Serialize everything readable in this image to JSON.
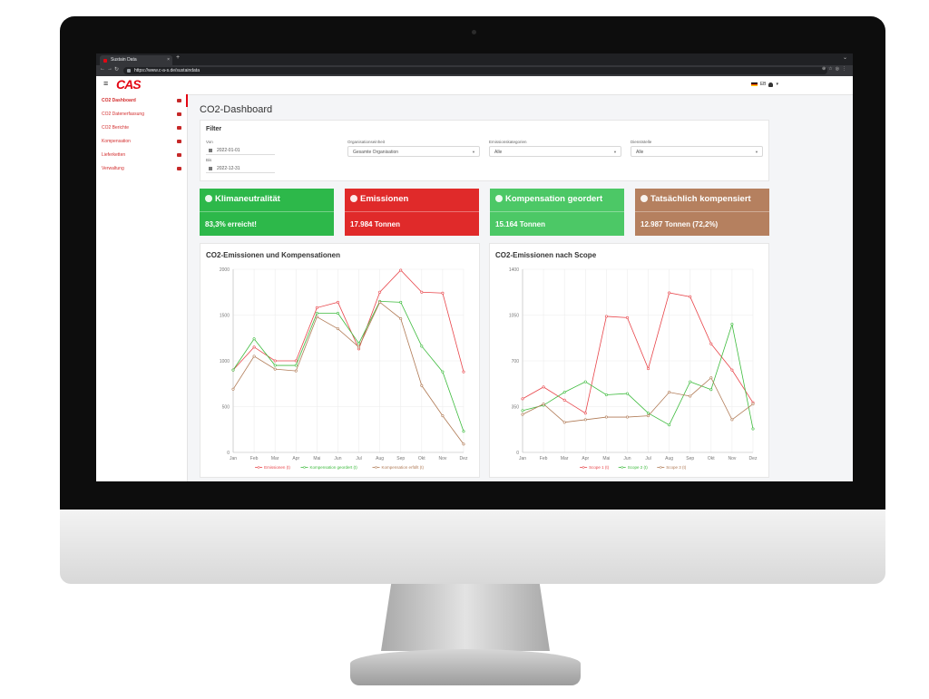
{
  "browser": {
    "tab_title": "Sustain Data",
    "tab_close": "×",
    "new_tab": "+",
    "url": "https://www.c-a-s.de/sustaindata",
    "back_icon": "arrow-left-icon",
    "forward_icon": "arrow-right-icon",
    "reload_icon": "reload-icon"
  },
  "header": {
    "logo": "CAS",
    "language": "EB"
  },
  "sidebar": {
    "items": [
      {
        "label": "CO2 Dashboard",
        "icon": "home-icon",
        "active": true
      },
      {
        "label": "CO2 Datenerfassung",
        "icon": "keyboard-icon"
      },
      {
        "label": "CO2 Berichte",
        "icon": "book-icon"
      },
      {
        "label": "Kompensation",
        "icon": "money-icon"
      },
      {
        "label": "Lieferketten",
        "icon": "truck-icon"
      },
      {
        "label": "Verwaltung",
        "icon": "wrench-icon"
      }
    ]
  },
  "page": {
    "title": "CO2-Dashboard"
  },
  "filter": {
    "heading": "Filter",
    "from_label": "Von",
    "from_value": "2022-01-01",
    "to_label": "Bis",
    "to_value": "2022-12-31",
    "org_label": "Organisationseinheit",
    "org_value": "Gesamte Organisation",
    "category_label": "Emissionskategorien",
    "category_value": "Alle",
    "service_label": "Dienststelle",
    "service_value": "Alle"
  },
  "kpis": [
    {
      "title": "Klimaneutralität",
      "value": "83,3% erreicht!",
      "color": "#2db84a",
      "icon": "globe-icon"
    },
    {
      "title": "Emissionen",
      "value": "17.984 Tonnen",
      "color": "#e02a2a",
      "icon": "industry-icon"
    },
    {
      "title": "Kompensation geordert",
      "value": "15.164 Tonnen",
      "color": "#4cc866",
      "icon": "tree-icon"
    },
    {
      "title": "Tatsächlich kompensiert",
      "value": "12.987 Tonnen (72,2%)",
      "color": "#b5805f",
      "icon": "clock-icon"
    }
  ],
  "chart_data": [
    {
      "type": "line",
      "title": "CO2-Emissionen und Kompensationen",
      "categories": [
        "Jan",
        "Feb",
        "Mar",
        "Apr",
        "Mai",
        "Jun",
        "Jul",
        "Aug",
        "Sep",
        "Okt",
        "Nov",
        "Dez"
      ],
      "ylim": [
        0,
        2000
      ],
      "yticks": [
        0,
        500,
        1000,
        1500,
        2000
      ],
      "grid": true,
      "legend": "bottom",
      "series": [
        {
          "name": "Emissionen (t)",
          "color": "#e8454a",
          "values": [
            900,
            1150,
            1000,
            1000,
            1580,
            1640,
            1130,
            1750,
            1990,
            1750,
            1740,
            880
          ]
        },
        {
          "name": "Kompensation geordert (t)",
          "color": "#3dbb3d",
          "values": [
            900,
            1240,
            950,
            950,
            1520,
            1520,
            1190,
            1650,
            1640,
            1160,
            880,
            230
          ]
        },
        {
          "name": "Kompensation erfüllt (t)",
          "color": "#b07a55",
          "values": [
            690,
            1050,
            910,
            890,
            1480,
            1350,
            1150,
            1640,
            1460,
            730,
            400,
            90
          ]
        }
      ]
    },
    {
      "type": "line",
      "title": "CO2-Emissionen nach Scope",
      "categories": [
        "Jan",
        "Feb",
        "Mar",
        "Apr",
        "Mai",
        "Jun",
        "Jul",
        "Aug",
        "Sep",
        "Okt",
        "Nov",
        "Dez"
      ],
      "ylim": [
        0,
        1400
      ],
      "yticks": [
        0,
        350,
        700,
        1050,
        1400
      ],
      "grid": true,
      "legend": "bottom",
      "series": [
        {
          "name": "Scope 1 (t)",
          "color": "#e8454a",
          "values": [
            410,
            500,
            400,
            300,
            1040,
            1030,
            640,
            1220,
            1190,
            830,
            630,
            380
          ]
        },
        {
          "name": "Scope 2 (t)",
          "color": "#3dbb3d",
          "values": [
            320,
            360,
            460,
            540,
            440,
            450,
            300,
            210,
            540,
            480,
            980,
            180
          ]
        },
        {
          "name": "Scope 3 (t)",
          "color": "#b07a55",
          "values": [
            290,
            370,
            230,
            250,
            270,
            270,
            280,
            460,
            430,
            570,
            250,
            370
          ]
        }
      ]
    }
  ]
}
